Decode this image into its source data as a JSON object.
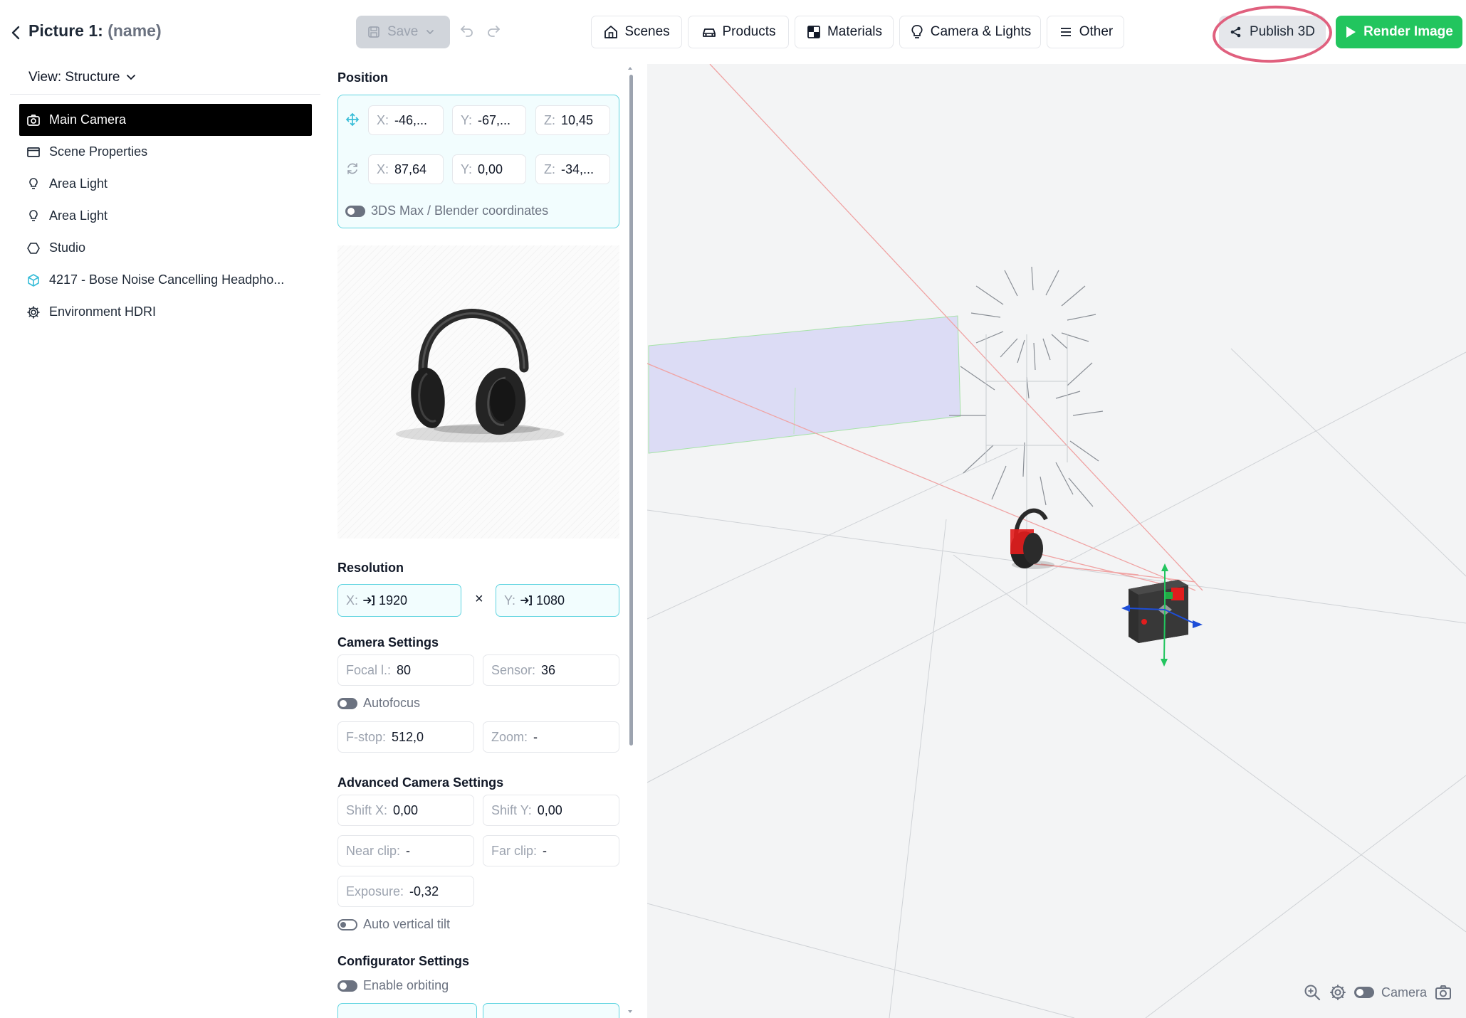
{
  "header": {
    "title_prefix": "Picture 1:",
    "title_name": "(name)",
    "save_label": "Save",
    "tabs": [
      {
        "label": "Scenes",
        "icon": "home-icon"
      },
      {
        "label": "Products",
        "icon": "car-icon"
      },
      {
        "label": "Materials",
        "icon": "material-icon"
      },
      {
        "label": "Camera & Lights",
        "icon": "lightbulb-icon"
      },
      {
        "label": "Other",
        "icon": "menu-icon"
      }
    ],
    "publish_label": "Publish 3D",
    "render_label": "Render Image"
  },
  "sidebar": {
    "view_label": "View: Structure",
    "items": [
      {
        "label": "Main Camera",
        "icon": "camera-icon",
        "selected": true
      },
      {
        "label": "Scene Properties",
        "icon": "window-icon"
      },
      {
        "label": "Area Light",
        "icon": "lightbulb-icon"
      },
      {
        "label": "Area Light",
        "icon": "lightbulb-icon"
      },
      {
        "label": "Studio",
        "icon": "hexagon-icon"
      },
      {
        "label": "4217 - Bose Noise Cancelling Headpho...",
        "icon": "cube-icon"
      },
      {
        "label": "Environment HDRI",
        "icon": "gear-icon"
      }
    ]
  },
  "position": {
    "heading": "Position",
    "translate": {
      "x": "-46,...",
      "y": "-67,...",
      "z": "10,45"
    },
    "rotate": {
      "x": "87,64",
      "y": "0,00",
      "z": "-34,..."
    },
    "labels": {
      "x": "X:",
      "y": "Y:",
      "z": "Z:"
    },
    "coord_toggle_label": "3DS Max / Blender coordinates"
  },
  "resolution": {
    "heading": "Resolution",
    "x_label": "X:",
    "x_value": "1920",
    "times": "×",
    "y_label": "Y:",
    "y_value": "1080"
  },
  "camera_settings": {
    "heading": "Camera Settings",
    "focal_label": "Focal l.:",
    "focal_value": "80",
    "sensor_label": "Sensor:",
    "sensor_value": "36",
    "autofocus_label": "Autofocus",
    "fstop_label": "F-stop:",
    "fstop_value": "512,0",
    "zoom_label": "Zoom:",
    "zoom_value": "-"
  },
  "advanced": {
    "heading": "Advanced Camera Settings",
    "shiftx_label": "Shift X:",
    "shiftx_value": "0,00",
    "shifty_label": "Shift Y:",
    "shifty_value": "0,00",
    "near_label": "Near clip:",
    "near_value": "-",
    "far_label": "Far clip:",
    "far_value": "-",
    "exposure_label": "Exposure:",
    "exposure_value": "-0,32",
    "tilt_label": "Auto vertical tilt"
  },
  "configurator": {
    "heading": "Configurator Settings",
    "orbit_label": "Enable orbiting"
  },
  "viewport": {
    "camera_toggle_label": "Camera"
  },
  "colors": {
    "accent_cyan": "#5fd4e0",
    "render_green": "#22c55e",
    "annotation_pink": "#e0607e"
  }
}
